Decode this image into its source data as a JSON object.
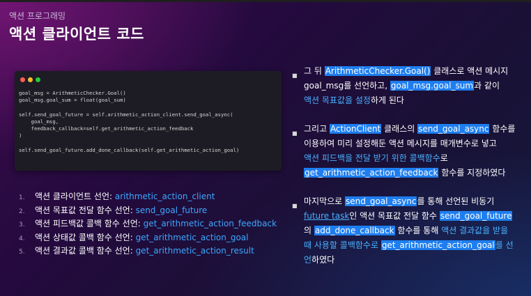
{
  "slide": {
    "subtitle": "액션 프로그래밍",
    "title": "액션 클라이언트 코드"
  },
  "code_window": {
    "dot_colors": [
      "#ff5f56",
      "#ffbd2e",
      "#27c93f"
    ],
    "lines": [
      "goal_msg = ArithmeticChecker.Goal()",
      "goal_msg.goal_sum = float(goal_sum)",
      "",
      "self.send_goal_future = self.arithmetic_action_client.send_goal_async(",
      "    goal_msg,",
      "    feedback_callback=self.get_arithmetic_action_feedback",
      ")",
      "",
      "self.send_goal_future.add_done_callback(self.get_arithmetic_action_goal)"
    ]
  },
  "list_items": [
    {
      "num": "1.",
      "label": "액션 클라이언트 선언: ",
      "value": "arithmetic_action_client"
    },
    {
      "num": "2.",
      "label": "액션 목표값 전달 함수 선언: ",
      "value": "send_goal_future"
    },
    {
      "num": "3.",
      "label": "액션 피드백값 콜백 함수 선언: ",
      "value": "get_arithmetic_action_feedback"
    },
    {
      "num": "4.",
      "label": "액션 상태값 콜백 함수 선언: ",
      "value": "get_arithmetic_action_goal"
    },
    {
      "num": "5.",
      "label": "액션 결과값 콜백 함수 선언: ",
      "value": "get_arithmetic_action_result"
    }
  ],
  "bullets": {
    "marker": "■",
    "b1": {
      "t1": "그 뒤 ",
      "h1": "ArithmeticChecker.Goal()",
      "t2": " 클래스로 액션 메시지",
      "t3": "goal_msg를 선언하고, ",
      "h2": "goal_msg.goal_sum",
      "t4": "과 같이",
      "blue1": "액션 목표값을 설정",
      "t5": "하게 된다"
    },
    "b2": {
      "t1": "그리고 ",
      "h1": "ActionClient",
      "t2": " 클래스의 ",
      "h2": "send_goal_async",
      "t3": " 함수를",
      "t4": "이용하여 미리 설정해둔 액션 메시지를 매개변수로 넣고",
      "blue1": "액션 피드백을 전달 받기 위한 콜백함수",
      "t5": "로",
      "h3": "get_arithmetic_action_feedback",
      "t6": " 함수를 지정하였다"
    },
    "b3": {
      "t1": "마지막으로 ",
      "h1": "send_goal_async",
      "t2": "를 통해 선언된 비동기",
      "u1": "future task",
      "t3": "인 액션 목표값 전달 함수 ",
      "h2": "send_goal_future",
      "t4": "의 ",
      "h3": "add_done_callback",
      "t5": " 함수를 통해 ",
      "blue1": "액션 결과값을 받을",
      "blue2": "때 사용할 콜백함수로 ",
      "h4": "get_arithmetic_action_goal",
      "blue3": "를 선",
      "blue4": "언",
      "t6": "하였다"
    }
  }
}
